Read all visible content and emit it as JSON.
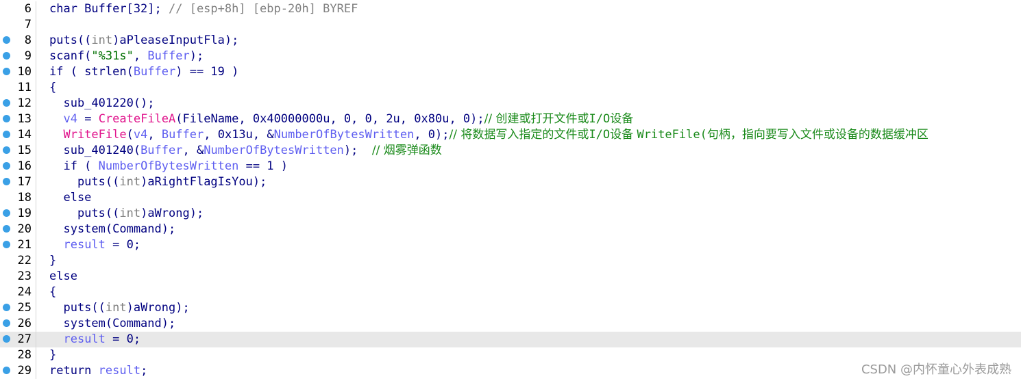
{
  "editor": {
    "lines": [
      {
        "n": "6",
        "bp": false,
        "current": false,
        "tokens": [
          {
            "t": "char Buffer[32]; ",
            "c": "code"
          },
          {
            "t": "// [esp+8h] [ebp-20h] BYREF",
            "c": "gray"
          }
        ]
      },
      {
        "n": "7",
        "bp": false,
        "current": false,
        "tokens": []
      },
      {
        "n": "8",
        "bp": true,
        "current": false,
        "tokens": [
          {
            "t": "puts((",
            "c": "code"
          },
          {
            "t": "int",
            "c": "gray"
          },
          {
            "t": ")aPleaseInputFla);",
            "c": "code"
          }
        ]
      },
      {
        "n": "9",
        "bp": true,
        "current": false,
        "tokens": [
          {
            "t": "scanf(",
            "c": "code"
          },
          {
            "t": "\"%31s\"",
            "c": "str"
          },
          {
            "t": ", ",
            "c": "code"
          },
          {
            "t": "Buffer",
            "c": "var"
          },
          {
            "t": ");",
            "c": "code"
          }
        ]
      },
      {
        "n": "10",
        "bp": true,
        "current": false,
        "tokens": [
          {
            "t": "if ( strlen(",
            "c": "code"
          },
          {
            "t": "Buffer",
            "c": "var"
          },
          {
            "t": ") == 19 )",
            "c": "code"
          }
        ]
      },
      {
        "n": "11",
        "bp": false,
        "current": false,
        "tokens": [
          {
            "t": "{",
            "c": "code"
          }
        ]
      },
      {
        "n": "12",
        "bp": true,
        "current": false,
        "tokens": [
          {
            "t": "  sub_401220();",
            "c": "code"
          }
        ]
      },
      {
        "n": "13",
        "bp": true,
        "current": false,
        "tokens": [
          {
            "t": "  ",
            "c": "code"
          },
          {
            "t": "v4",
            "c": "var"
          },
          {
            "t": " = ",
            "c": "code"
          },
          {
            "t": "CreateFileA",
            "c": "imp"
          },
          {
            "t": "(FileName, 0x40000000u, 0, 0, 2u, 0x80u, 0);",
            "c": "code"
          },
          {
            "t": "// 创建或打开文件或",
            "c": "cmt"
          },
          {
            "t": "I/O",
            "c": "cmtcode"
          },
          {
            "t": "设备",
            "c": "cmt"
          }
        ]
      },
      {
        "n": "14",
        "bp": true,
        "current": false,
        "tokens": [
          {
            "t": "  ",
            "c": "code"
          },
          {
            "t": "WriteFile",
            "c": "imp"
          },
          {
            "t": "(",
            "c": "code"
          },
          {
            "t": "v4",
            "c": "var"
          },
          {
            "t": ", ",
            "c": "code"
          },
          {
            "t": "Buffer",
            "c": "var"
          },
          {
            "t": ", 0x13u, &",
            "c": "code"
          },
          {
            "t": "NumberOfBytesWritten",
            "c": "var"
          },
          {
            "t": ", 0);",
            "c": "code"
          },
          {
            "t": "// 将数据写入指定的文件或",
            "c": "cmt"
          },
          {
            "t": "I/O",
            "c": "cmtcode"
          },
          {
            "t": "设备 ",
            "c": "cmt"
          },
          {
            "t": "WriteFile(",
            "c": "cmtcode"
          },
          {
            "t": "句柄，指向要写入文件或设备的数据缓冲区",
            "c": "cmt"
          }
        ]
      },
      {
        "n": "15",
        "bp": true,
        "current": false,
        "tokens": [
          {
            "t": "  sub_401240(",
            "c": "code"
          },
          {
            "t": "Buffer",
            "c": "var"
          },
          {
            "t": ", &",
            "c": "code"
          },
          {
            "t": "NumberOfBytesWritten",
            "c": "var"
          },
          {
            "t": ");  ",
            "c": "code"
          },
          {
            "t": "// 烟雾弹函数",
            "c": "cmt"
          }
        ]
      },
      {
        "n": "16",
        "bp": true,
        "current": false,
        "tokens": [
          {
            "t": "  if ( ",
            "c": "code"
          },
          {
            "t": "NumberOfBytesWritten",
            "c": "var"
          },
          {
            "t": " == 1 )",
            "c": "code"
          }
        ]
      },
      {
        "n": "17",
        "bp": true,
        "current": false,
        "tokens": [
          {
            "t": "    puts((",
            "c": "code"
          },
          {
            "t": "int",
            "c": "gray"
          },
          {
            "t": ")aRightFlagIsYou);",
            "c": "code"
          }
        ]
      },
      {
        "n": "18",
        "bp": false,
        "current": false,
        "tokens": [
          {
            "t": "  else",
            "c": "code"
          }
        ]
      },
      {
        "n": "19",
        "bp": true,
        "current": false,
        "tokens": [
          {
            "t": "    puts((",
            "c": "code"
          },
          {
            "t": "int",
            "c": "gray"
          },
          {
            "t": ")aWrong);",
            "c": "code"
          }
        ]
      },
      {
        "n": "20",
        "bp": true,
        "current": false,
        "tokens": [
          {
            "t": "  system(Command);",
            "c": "code"
          }
        ]
      },
      {
        "n": "21",
        "bp": true,
        "current": false,
        "tokens": [
          {
            "t": "  ",
            "c": "code"
          },
          {
            "t": "result",
            "c": "var"
          },
          {
            "t": " = 0;",
            "c": "code"
          }
        ]
      },
      {
        "n": "22",
        "bp": false,
        "current": false,
        "tokens": [
          {
            "t": "}",
            "c": "code"
          }
        ]
      },
      {
        "n": "23",
        "bp": false,
        "current": false,
        "tokens": [
          {
            "t": "else",
            "c": "code"
          }
        ]
      },
      {
        "n": "24",
        "bp": false,
        "current": false,
        "tokens": [
          {
            "t": "{",
            "c": "code"
          }
        ]
      },
      {
        "n": "25",
        "bp": true,
        "current": false,
        "tokens": [
          {
            "t": "  puts((",
            "c": "code"
          },
          {
            "t": "int",
            "c": "gray"
          },
          {
            "t": ")aWrong);",
            "c": "code"
          }
        ]
      },
      {
        "n": "26",
        "bp": true,
        "current": false,
        "tokens": [
          {
            "t": "  system(Command);",
            "c": "code"
          }
        ]
      },
      {
        "n": "27",
        "bp": true,
        "current": true,
        "tokens": [
          {
            "t": "  ",
            "c": "code"
          },
          {
            "t": "result",
            "c": "var"
          },
          {
            "t": " = 0;",
            "c": "code"
          }
        ]
      },
      {
        "n": "28",
        "bp": false,
        "current": false,
        "tokens": [
          {
            "t": "}",
            "c": "code"
          }
        ]
      },
      {
        "n": "29",
        "bp": true,
        "current": false,
        "tokens": [
          {
            "t": "return ",
            "c": "code"
          },
          {
            "t": "result",
            "c": "var"
          },
          {
            "t": ";",
            "c": "code"
          }
        ]
      }
    ]
  },
  "watermark": "CSDN @内怀童心外表成熟",
  "colors": {
    "code": "#000080",
    "gray": "#808080",
    "var": "#5e5ef0",
    "string": "#007000",
    "import": "#e0148c",
    "comment": "#1a8a1a",
    "breakpoint": "#3aa0e6",
    "current_line": "#e8e8e8"
  }
}
